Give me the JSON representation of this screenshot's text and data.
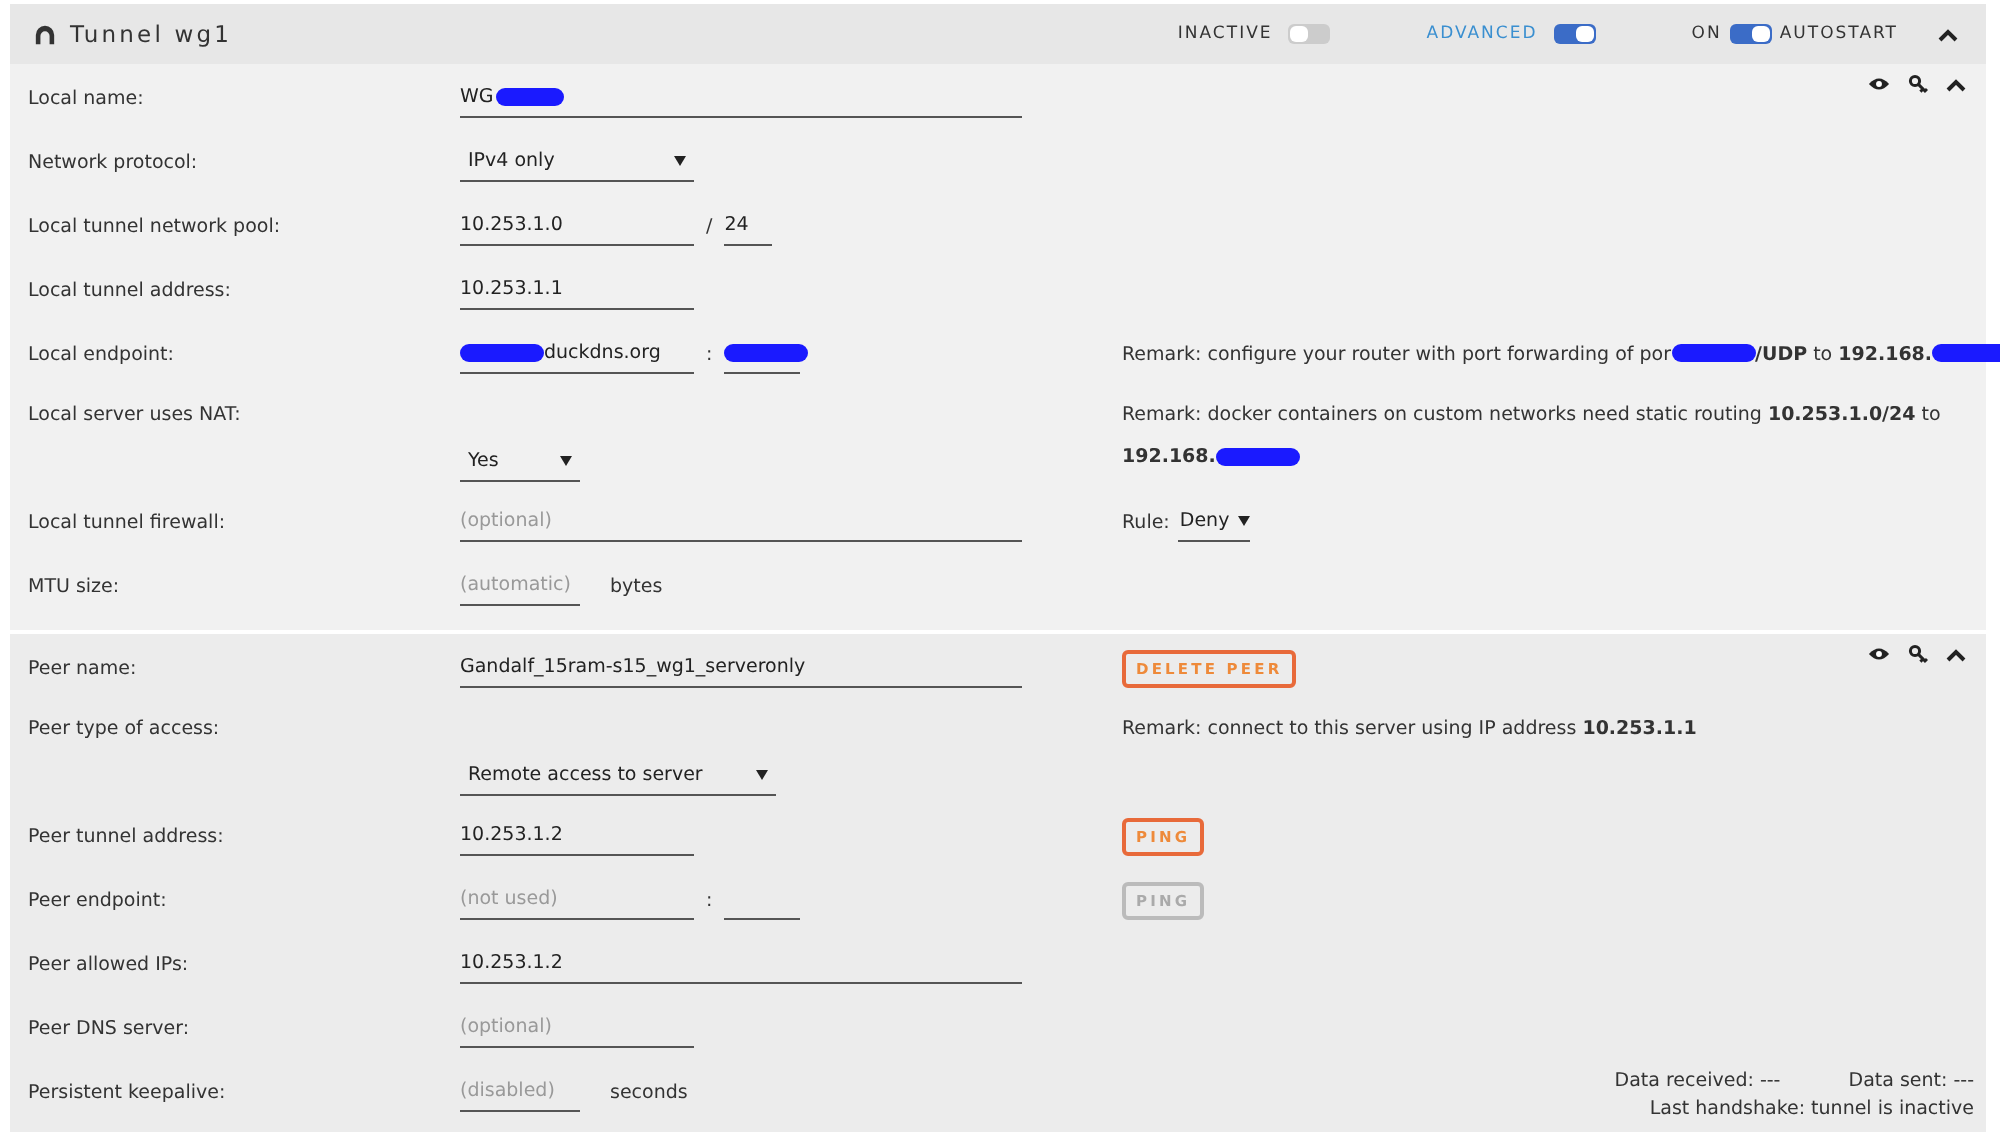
{
  "header": {
    "title": "Tunnel wg1",
    "toggles": [
      {
        "label_before": "INACTIVE",
        "on": false
      },
      {
        "label_before": "ADVANCED",
        "on": true
      },
      {
        "label_before": "ON",
        "label_after": "AUTOSTART",
        "on": true
      }
    ]
  },
  "sections": [
    {
      "rows": [
        {
          "kind": "single",
          "label": "Local name:",
          "fields": [
            {
              "kind": "text",
              "value": "WG",
              "redacted_after": true
            }
          ]
        },
        {
          "kind": "single",
          "label": "Network protocol:",
          "fields": [
            {
              "kind": "select",
              "value": "IPv4 only"
            }
          ]
        },
        {
          "kind": "single",
          "label": "Local tunnel network pool:",
          "fields": [
            {
              "kind": "text",
              "value": "10.253.1.0"
            },
            {
              "kind": "separator",
              "text": "/"
            },
            {
              "kind": "text",
              "value": "24"
            }
          ]
        },
        {
          "kind": "single",
          "label": "Local tunnel address:",
          "fields": [
            {
              "kind": "text",
              "value": "10.253.1.1"
            }
          ]
        },
        {
          "kind": "single",
          "label": "Local endpoint:",
          "fields": [
            {
              "kind": "text",
              "value": "duckdns.org",
              "redacted_before": true
            },
            {
              "kind": "separator",
              "text": ":"
            },
            {
              "kind": "text",
              "redacted_before": true
            }
          ],
          "remark": [
            {
              "kind": "text",
              "text": "Remark: configure your router with port forwarding of por"
            },
            {
              "kind": "redaction"
            },
            {
              "kind": "text",
              "text": "**/UDP** to **192.168.**"
            },
            {
              "kind": "redaction"
            }
          ]
        },
        {
          "kind": "split",
          "label": "Local server uses NAT:",
          "fields": [
            {
              "kind": "select",
              "value": "Yes"
            }
          ],
          "remark": [
            {
              "kind": "text",
              "text": "Remark: docker containers on custom networks need static routing **10.253.1.0/24** to **192.168.**"
            },
            {
              "kind": "redaction"
            }
          ]
        },
        {
          "kind": "single",
          "label": "Local tunnel firewall:",
          "fields": [
            {
              "kind": "text",
              "placeholder": "(optional)"
            }
          ],
          "rule": {
            "label": "Rule:",
            "value": "Deny"
          }
        },
        {
          "kind": "single",
          "label": "MTU size:",
          "fields": [
            {
              "kind": "text",
              "placeholder": "(automatic)"
            },
            {
              "kind": "unit",
              "text": "bytes"
            }
          ]
        }
      ]
    },
    {
      "rows": [
        {
          "kind": "single",
          "label": "Peer name:",
          "fields": [
            {
              "kind": "text",
              "value": "Gandalf_15ram-s15_wg1_serveronly"
            }
          ],
          "button": {
            "label": "DELETE PEER",
            "disabled": false
          }
        },
        {
          "kind": "split",
          "label": "Peer type of access:",
          "fields": [
            {
              "kind": "select",
              "value": "Remote access to server"
            }
          ],
          "remark": [
            {
              "kind": "text",
              "text": "Remark: connect to this server using IP address **10.253.1.1**"
            }
          ]
        },
        {
          "kind": "single",
          "label": "Peer tunnel address:",
          "fields": [
            {
              "kind": "text",
              "value": "10.253.1.2"
            }
          ],
          "button": {
            "label": "PING",
            "disabled": false
          }
        },
        {
          "kind": "single",
          "label": "Peer endpoint:",
          "fields": [
            {
              "kind": "text",
              "placeholder": "(not used)"
            },
            {
              "kind": "separator",
              "text": ":"
            },
            {
              "kind": "text"
            }
          ],
          "button": {
            "label": "PING",
            "disabled": true
          }
        },
        {
          "kind": "single",
          "label": "Peer allowed IPs:",
          "fields": [
            {
              "kind": "text",
              "value": "10.253.1.2"
            }
          ]
        },
        {
          "kind": "single",
          "label": "Peer DNS server:",
          "fields": [
            {
              "kind": "text",
              "placeholder": "(optional)"
            }
          ]
        },
        {
          "kind": "single",
          "label": "Persistent keepalive:",
          "fields": [
            {
              "kind": "text",
              "placeholder": "(disabled)"
            },
            {
              "kind": "unit",
              "text": "seconds"
            }
          ],
          "stats": {
            "received": "Data received: ---",
            "sent": "Data sent: ---",
            "handshake": "Last handshake: tunnel is inactive"
          }
        }
      ]
    }
  ]
}
